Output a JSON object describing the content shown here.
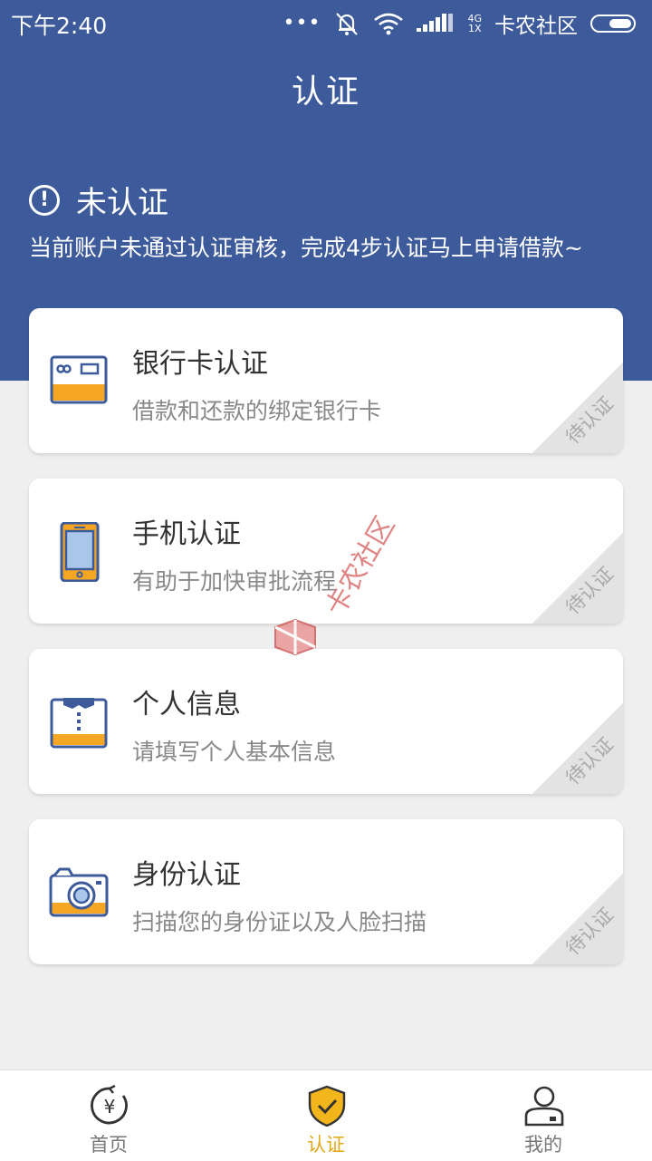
{
  "status_bar": {
    "time": "下午2:40",
    "dots": "•••",
    "net_top": "4G",
    "net_bottom": "1X",
    "carrier": "卡农社区"
  },
  "header": {
    "title": "认证",
    "status_title": "未认证",
    "status_desc": "当前账户未通过认证审核，完成4步认证马上申请借款~"
  },
  "cards": [
    {
      "title": "银行卡认证",
      "subtitle": "借款和还款的绑定银行卡",
      "badge": "待认证",
      "icon": "bank-card-icon"
    },
    {
      "title": "手机认证",
      "subtitle": "有助于加快审批流程",
      "badge": "待认证",
      "icon": "phone-icon"
    },
    {
      "title": "个人信息",
      "subtitle": "请填写个人基本信息",
      "badge": "待认证",
      "icon": "personal-info-icon"
    },
    {
      "title": "身份认证",
      "subtitle": "扫描您的身份证以及人脸扫描",
      "badge": "待认证",
      "icon": "camera-icon"
    }
  ],
  "watermark": {
    "text": "卡农社区"
  },
  "nav": [
    {
      "label": "首页",
      "icon": "home-yen-icon",
      "active": false
    },
    {
      "label": "认证",
      "icon": "shield-check-icon",
      "active": true
    },
    {
      "label": "我的",
      "icon": "user-icon",
      "active": false
    }
  ],
  "colors": {
    "header_blue": "#3d5a9b",
    "accent_orange": "#f5a623",
    "nav_active": "#e2a91b"
  }
}
